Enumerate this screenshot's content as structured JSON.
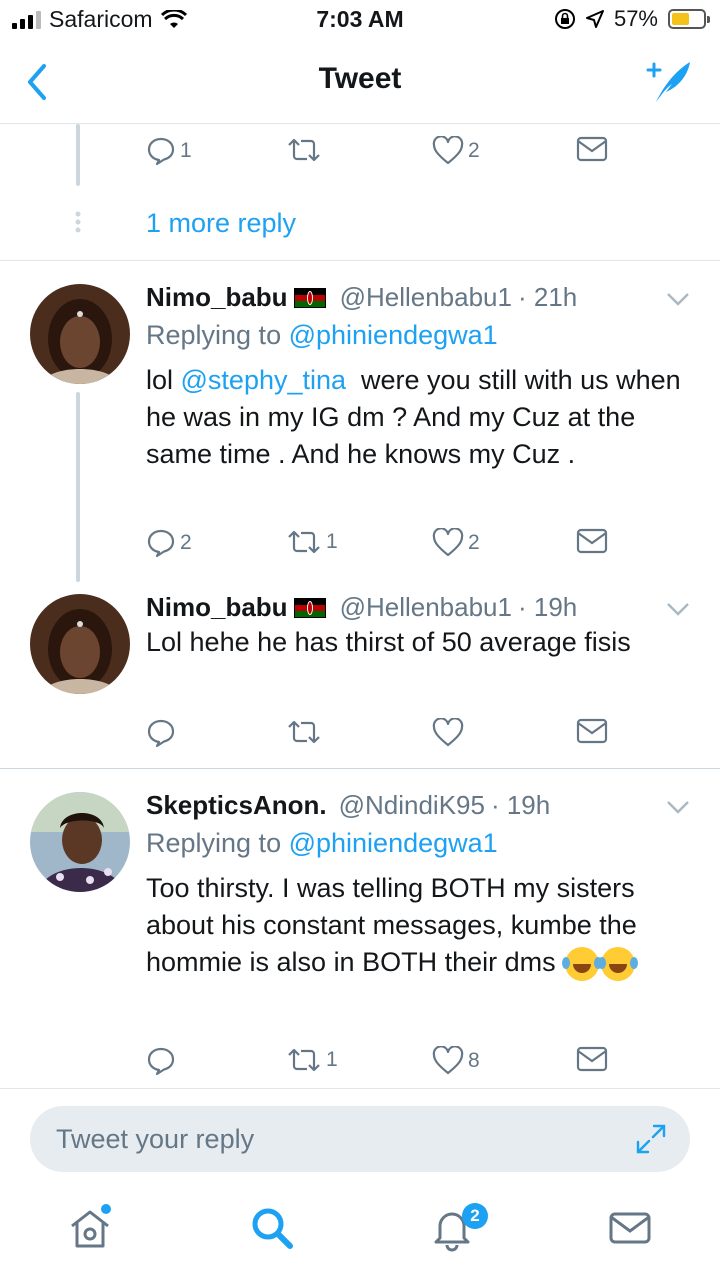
{
  "status_bar": {
    "carrier": "Safaricom",
    "time": "7:03 AM",
    "battery_percent": "57%",
    "battery_level": 0.57
  },
  "nav": {
    "title": "Tweet"
  },
  "top_fragment": {
    "actions": {
      "reply_count": "1",
      "retweet_count": "",
      "like_count": "2"
    },
    "more_replies": "1 more reply"
  },
  "tweets": [
    {
      "name": "Nimo_babu",
      "handle": "@Hellenbabu1",
      "time": "· 21h",
      "replying_prefix": "Replying to ",
      "replying_to": "@phiniendegwa1",
      "text_lead": "lol ",
      "mention": "@stephy_tina",
      "text_rest": "  were you still with us when he was in my IG dm ? And my Cuz at the same time . And he knows my Cuz .",
      "reply_count": "2",
      "retweet_count": "1",
      "like_count": "2"
    },
    {
      "name": "Nimo_babu",
      "handle": "@Hellenbabu1",
      "time": "· 19h",
      "text": "Lol hehe he has thirst of 50 average fisis",
      "reply_count": "",
      "retweet_count": "",
      "like_count": ""
    },
    {
      "name": "SkepticsAnon.",
      "handle": "@NdindiK95",
      "time": "· 19h",
      "replying_prefix": "Replying to ",
      "replying_to": "@phiniendegwa1",
      "text": "Too thirsty. I was telling BOTH my sisters about his constant messages, kumbe the hommie is also in BOTH their dms",
      "reply_count": "",
      "retweet_count": "1",
      "like_count": "8"
    }
  ],
  "reply_bar": {
    "placeholder": "Tweet your reply"
  },
  "tabs": {
    "notifications_badge": "2"
  },
  "colors": {
    "accent": "#1da1f2",
    "muted": "#657786",
    "divider": "#e1e8ed"
  },
  "icons": [
    "back-icon",
    "compose-icon",
    "reply-icon",
    "retweet-icon",
    "like-icon",
    "dm-icon",
    "chevron-down-icon",
    "home-icon",
    "search-icon",
    "notifications-icon",
    "messages-icon",
    "expand-icon"
  ]
}
